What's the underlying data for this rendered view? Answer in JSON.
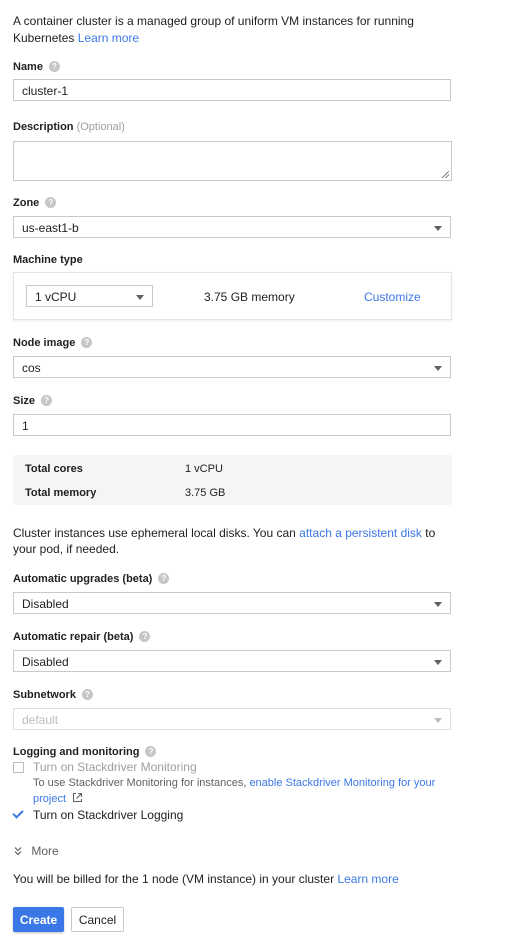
{
  "intro": {
    "text_line1": "A container cluster is a managed group of uniform VM instances for running",
    "text_line2": "Kubernetes",
    "learn_more": "Learn more"
  },
  "name": {
    "label": "Name",
    "value": "cluster-1"
  },
  "description": {
    "label": "Description",
    "optional": "(Optional)",
    "value": ""
  },
  "zone": {
    "label": "Zone",
    "value": "us-east1-b"
  },
  "machine_type": {
    "label": "Machine type",
    "cpu": "1 vCPU",
    "memory": "3.75 GB memory",
    "customize": "Customize"
  },
  "node_image": {
    "label": "Node image",
    "value": "cos"
  },
  "size": {
    "label": "Size",
    "value": "1"
  },
  "summary": {
    "total_cores_label": "Total cores",
    "total_cores_value": "1 vCPU",
    "total_memory_label": "Total memory",
    "total_memory_value": "3.75 GB"
  },
  "disks": {
    "text_before": "Cluster instances use ephemeral local disks. You can",
    "link": "attach a persistent disk",
    "text_after": "to",
    "line2": "your pod, if needed."
  },
  "auto_upgrades": {
    "label": "Automatic upgrades (beta)",
    "value": "Disabled"
  },
  "auto_repair": {
    "label": "Automatic repair (beta)",
    "value": "Disabled"
  },
  "subnetwork": {
    "label": "Subnetwork",
    "value": "default"
  },
  "logging": {
    "label": "Logging and monitoring",
    "monitoring_label": "Turn on Stackdriver Monitoring",
    "monitoring_hint": "To use Stackdriver Monitoring for instances,",
    "monitoring_link": "enable Stackdriver Monitoring for your",
    "monitoring_link2": "project",
    "logging_label": "Turn on Stackdriver Logging"
  },
  "more": {
    "label": "More"
  },
  "billing": {
    "text": "You will be billed for the 1 node (VM instance) in your cluster",
    "learn_more": "Learn more"
  },
  "actions": {
    "create": "Create",
    "cancel": "Cancel"
  },
  "colors": {
    "accent": "#3b78e7",
    "text": "#212121",
    "muted": "#9e9e9e"
  }
}
